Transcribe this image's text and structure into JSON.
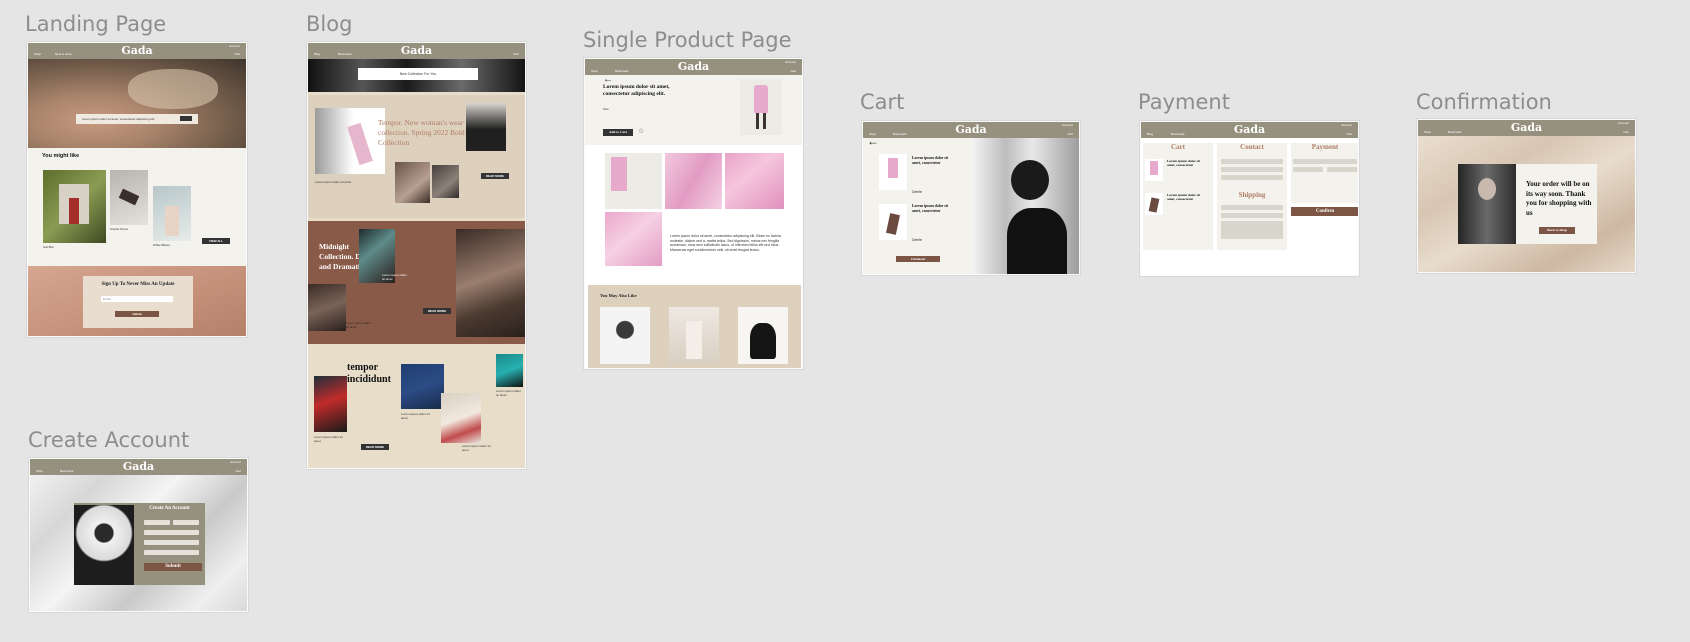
{
  "canvas": {
    "background": "#e5e5e5"
  },
  "frames": {
    "landing": "Landing Page",
    "blog": "Blog",
    "product": "Single Product Page",
    "cart": "Cart",
    "payment": "Payment",
    "confirmation": "Confirmation",
    "create_account": "Create Account"
  },
  "common": {
    "brand": "Gada",
    "nav_shop": "Shop",
    "nav_blog": "Blog",
    "nav_new": "New in store",
    "nav_bookmark": "Bookmark",
    "nav_account": "Account",
    "nav_cart": "Cart"
  },
  "landing": {
    "hero_text": "Lorem ipsum dolor sit amet, consectetur adipiscing elit.",
    "might_like": "You might like",
    "products": [
      "Gat Bon",
      "Scarlet Dress",
      "White Blazer"
    ],
    "view_all": "VIEW ALL",
    "signup_title": "Sign Up To Never Miss An Update",
    "email_placeholder": "Email",
    "submit": "Submit"
  },
  "blog": {
    "banner": "New Collection For You",
    "headline1": "Tempor. New woman's wear collection. Spring 2022 Bold Collection",
    "caption1": "Lorem ipsum dolor sit amet",
    "headline2": "Midnight Collection. Dark and Dramatic",
    "caption2": "Lorem ipsum dolor sit amet",
    "caption3": "Lorem ipsum dolor sit amet",
    "headline3": "tempor incididunt",
    "caption4": "Lorem ipsum dolor sit amet",
    "caption5": "Lorem ipsum dolor sit amet",
    "caption6": "Lorem ipsum dolor sit amet",
    "caption7": "Lorem ipsum dolor sit amet",
    "button": "READ MORE"
  },
  "product": {
    "title": "Lorem ipsum dolor sit amet, consectetur adipiscing elit.",
    "size": "Size",
    "add_to_cart": "Add to Cart",
    "description": "Lorem ipsum dolor sit amet, consectetur adipiscing elit. Etiam eu lacinia molestie, dictum sed a, mattis tellus. Sed dignissim, metus nec fringilla accumsan, risus sem sollicitudin lacus, ut interdum tellus elit sed risus. Maecenas eget condimentum velit, sit amet feugiat lectus.",
    "also_like": "You May Also Like"
  },
  "cart": {
    "item_text": "Lorem ipsum dolor sit amet, consectetur",
    "delete": "Delete",
    "checkout": "Checkout"
  },
  "payment": {
    "cart": "Cart",
    "contact": "Contact",
    "shipping": "Shipping",
    "payment": "Payment",
    "item_text": "Lorem ipsum dolor sit amet, consectetur",
    "confirm": "Confirm"
  },
  "confirmation": {
    "message": "Your order will be on its way soon. Thank you for shopping with us",
    "button": "Back to Shop"
  },
  "create_account": {
    "title": "Create An Account",
    "submit": "Submit"
  },
  "colors": {
    "nav": "#96917f",
    "accent": "#7d5545",
    "beige": "#ddd0bd",
    "cream": "#f3f2ed",
    "pink": "#e7a9cc",
    "brown": "#8a5a48"
  }
}
